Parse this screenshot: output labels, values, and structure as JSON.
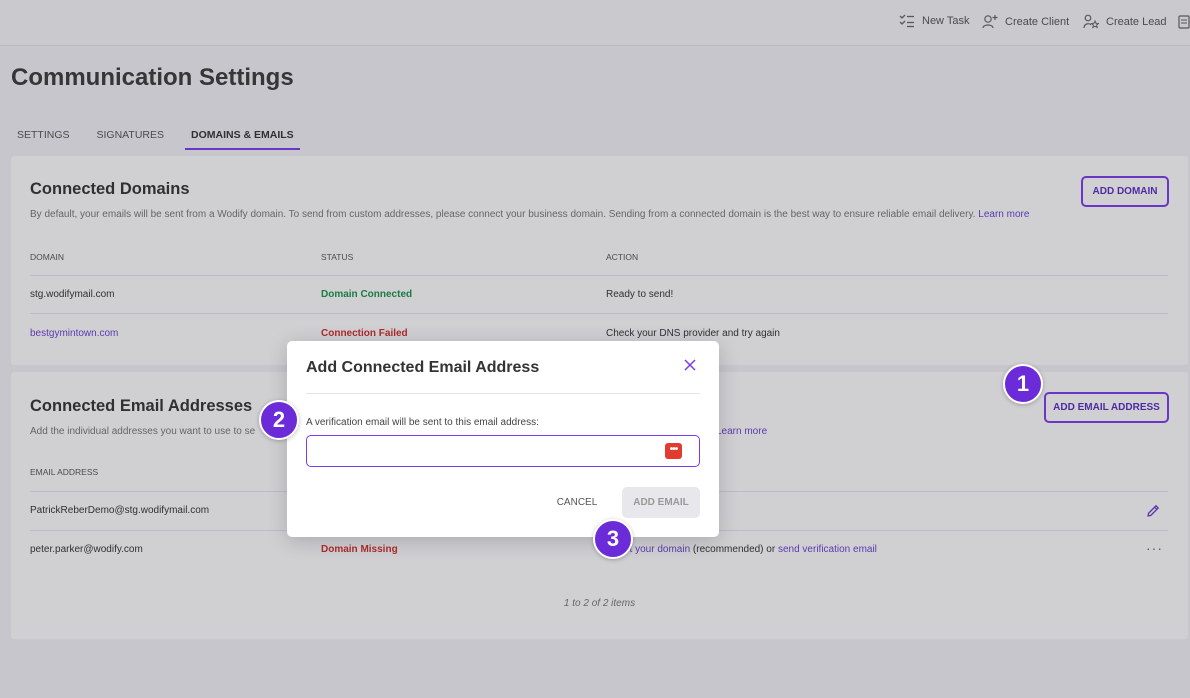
{
  "header": {
    "actions": [
      {
        "label": "New Task",
        "icon": "task-list-icon"
      },
      {
        "label": "Create Client",
        "icon": "user-add-icon"
      },
      {
        "label": "Create Lead",
        "icon": "lead-star-icon"
      },
      {
        "label": "",
        "icon": "notes-icon"
      }
    ]
  },
  "page": {
    "title": "Communication Settings"
  },
  "tabs": [
    {
      "label": "SETTINGS",
      "active": false
    },
    {
      "label": "SIGNATURES",
      "active": false
    },
    {
      "label": "DOMAINS & EMAILS",
      "active": true
    }
  ],
  "domains": {
    "title": "Connected Domains",
    "description": "By default, your emails will be sent from a Wodify domain. To send from custom addresses, please connect your business domain. Sending from a connected domain is the best way to ensure reliable email delivery.",
    "learn_more": "Learn more",
    "add_button": "ADD DOMAIN",
    "columns": [
      "DOMAIN",
      "STATUS",
      "ACTION"
    ],
    "rows": [
      {
        "domain": "stg.wodifymail.com",
        "status": "Domain Connected",
        "action": "Ready to send!"
      },
      {
        "domain": "bestgymintown.com",
        "status": "Connection Failed",
        "action": "Check your DNS provider and try again"
      }
    ]
  },
  "emails": {
    "title": "Connected Email Addresses",
    "description_start": "Add the individual addresses you want to use to se",
    "learn_more": "Learn more",
    "add_button": "ADD EMAIL ADDRESS",
    "columns": [
      "EMAIL ADDRESS"
    ],
    "rows": [
      {
        "email": "PatrickReberDemo@stg.wodifymail.com"
      },
      {
        "email": "peter.parker@wodify.com",
        "status": "Domain Missing",
        "action_part1": "ect your domain",
        "action_part2": " (recommended) or ",
        "action_link": "send verification email"
      }
    ],
    "pagination": "1 to 2 of 2 items"
  },
  "modal": {
    "title": "Add Connected Email Address",
    "label": "A verification email will be sent to this email address:",
    "input_value": "",
    "cancel_label": "CANCEL",
    "submit_label": "ADD EMAIL"
  },
  "steps": [
    "1",
    "2",
    "3"
  ],
  "colors": {
    "accent": "#7c3aed",
    "success": "#17924a",
    "error": "#d12c2c",
    "step_badge": "#6b2bd9"
  }
}
